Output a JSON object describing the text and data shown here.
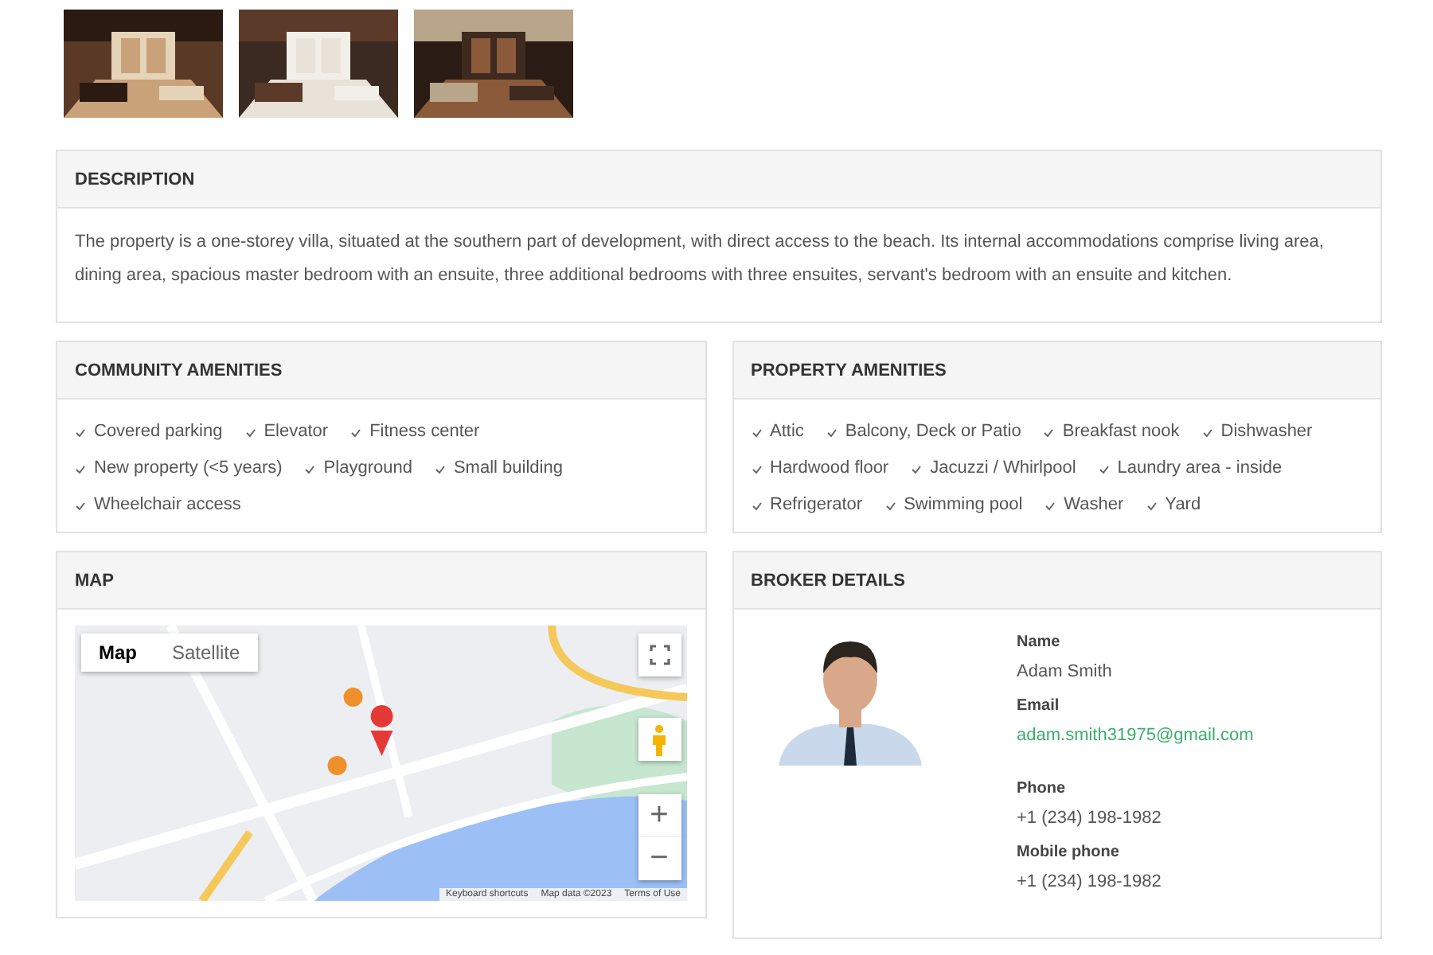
{
  "description": {
    "title": "DESCRIPTION",
    "text": "The property is a one-storey villa, situated at the southern part of development, with direct access to the beach. Its internal accommodations comprise living area, dining area, spacious master bedroom with an ensuite, three additional bedrooms with three ensuites, servant's bedroom with an ensuite and kitchen."
  },
  "community_amenities": {
    "title": "COMMUNITY AMENITIES",
    "items": [
      "Covered parking",
      "Elevator",
      "Fitness center",
      "New property (<5 years)",
      "Playground",
      "Small building",
      "Wheelchair access"
    ]
  },
  "property_amenities": {
    "title": "PROPERTY AMENITIES",
    "items": [
      "Attic",
      "Balcony, Deck or Patio",
      "Breakfast nook",
      "Dishwasher",
      "Hardwood floor",
      "Jacuzzi / Whirlpool",
      "Laundry area - inside",
      "Refrigerator",
      "Swimming pool",
      "Washer",
      "Yard"
    ]
  },
  "map": {
    "title": "MAP",
    "map_types": [
      {
        "label": "Map",
        "selected": true
      },
      {
        "label": "Satellite",
        "selected": false
      }
    ],
    "zoom_in": "+",
    "zoom_out": "−",
    "attribution": [
      "Keyboard shortcuts",
      "Map data ©2023",
      "Terms of Use"
    ]
  },
  "broker": {
    "title": "BROKER DETAILS",
    "fields": [
      {
        "label": "Name",
        "value": "Adam Smith",
        "kind": "text"
      },
      {
        "label": "Email",
        "value": "adam.smith31975@gmail.com",
        "kind": "link"
      },
      {
        "label": "Phone",
        "value": "+1 (234) 198-1982",
        "kind": "text"
      },
      {
        "label": "Mobile phone",
        "value": "+1 (234) 198-1982",
        "kind": "text"
      }
    ]
  }
}
